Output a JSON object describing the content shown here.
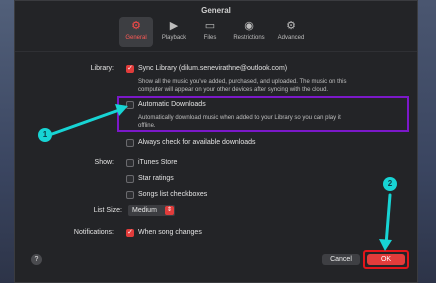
{
  "window": {
    "title": "General"
  },
  "tabs": [
    {
      "label": "General",
      "icon": "gear-icon",
      "active": true
    },
    {
      "label": "Playback",
      "icon": "play-icon",
      "active": false
    },
    {
      "label": "Files",
      "icon": "folder-icon",
      "active": false
    },
    {
      "label": "Restrictions",
      "icon": "restrictions-icon",
      "active": false
    },
    {
      "label": "Advanced",
      "icon": "advanced-gear-icon",
      "active": false
    }
  ],
  "library": {
    "label": "Library:",
    "sync_label": "Sync Library (dilum.senevirathne@outlook.com)",
    "sync_checked": true,
    "sync_desc_line1": "Show all the music you've added, purchased, and uploaded. The music on this",
    "sync_desc_line2": "computer will appear on your other devices after syncing with the cloud.",
    "auto_label": "Automatic Downloads",
    "auto_checked": false,
    "auto_desc_line1": "Automatically download music when added to your Library so you can play it",
    "auto_desc_line2": "offline.",
    "always_label": "Always check for available downloads",
    "always_checked": false
  },
  "show": {
    "label": "Show:",
    "items": [
      {
        "label": "iTunes Store",
        "checked": false
      },
      {
        "label": "Star ratings",
        "checked": false
      },
      {
        "label": "Songs list checkboxes",
        "checked": false
      }
    ]
  },
  "list_size": {
    "label": "List Size:",
    "value": "Medium"
  },
  "notifications": {
    "label": "Notifications:",
    "option_label": "When song changes",
    "checked": true
  },
  "buttons": {
    "help": "?",
    "cancel": "Cancel",
    "ok": "OK"
  },
  "annotations": {
    "marker1": "1",
    "marker2": "2"
  },
  "colors": {
    "accent": "#e23c3b",
    "highlight_box": "#7b18c9",
    "annotation": "#17d4d4",
    "ok_ring": "#e2151a"
  }
}
